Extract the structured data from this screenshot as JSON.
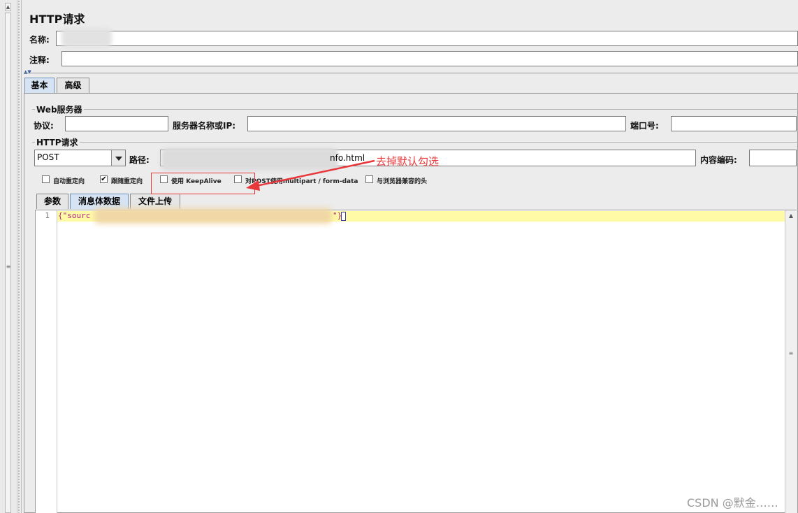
{
  "window": {
    "title": "HTTP请求"
  },
  "fields": {
    "name_label": "名称:",
    "comment_label": "注释:"
  },
  "tabs": [
    {
      "label": "基本",
      "active": true
    },
    {
      "label": "高级",
      "active": false
    }
  ],
  "web_server": {
    "group_title": "Web服务器",
    "protocol_label": "协议:",
    "server_label": "服务器名称或IP:",
    "port_label": "端口号:"
  },
  "http_request": {
    "group_title": "HTTP请求",
    "method": "POST",
    "path_label": "路径:",
    "path_value_tail": "nfo.html",
    "encoding_label": "内容编码:"
  },
  "options": [
    {
      "label": "自动重定向",
      "checked": false
    },
    {
      "label": "跟随重定向",
      "checked": true
    },
    {
      "label": "使用 KeepAlive",
      "checked": false
    },
    {
      "label": "对POST使用multipart / form-data",
      "checked": false
    },
    {
      "label": "与浏览器兼容的头",
      "checked": false
    }
  ],
  "check_mark": "✔",
  "sub_tabs": [
    {
      "label": "参数",
      "active": false
    },
    {
      "label": "消息体数据",
      "active": true
    },
    {
      "label": "文件上传",
      "active": false
    }
  ],
  "editor": {
    "line_number": "1",
    "code_start": "{\"sourc",
    "code_end": "\"}"
  },
  "annotation": {
    "text": "去掉默认勾选",
    "color": "#e8383b"
  },
  "watermark": "CSDN @默金……",
  "colors": {
    "highlight_line": "#fffaa6",
    "active_tab": "#d6e3f2",
    "code_text": "#b0227f"
  }
}
